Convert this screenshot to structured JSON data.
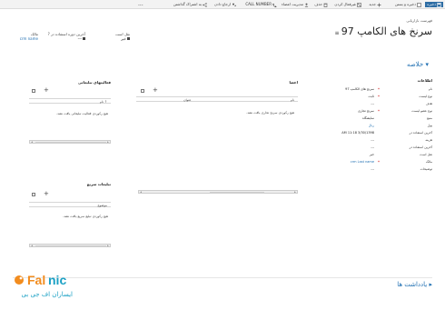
{
  "toolbar": {
    "items": [
      {
        "label": "ذخیره"
      },
      {
        "label": "ذخیره و بستن"
      },
      {
        "label": "جدید"
      },
      {
        "label": "غیرفعال کردن"
      },
      {
        "label": "حذف"
      },
      {
        "label": "مدیریت اعضاء"
      },
      {
        "label": "CALL NUMBER"
      },
      {
        "label": "ارجاع دادن"
      },
      {
        "label": "به اشتراک گذاشتن"
      }
    ],
    "more": "..."
  },
  "header": {
    "breadcrumb": "فهرست بازاریابی",
    "title": "سرنخ های الکامپ 97",
    "title_menu": "≡",
    "fields": [
      {
        "label": "نقل است",
        "value": "خیر"
      },
      {
        "label": "آخرین دوره استفاده در ?",
        "value": "---"
      },
      {
        "label": "مالک",
        "value": "crm name"
      }
    ]
  },
  "summary": {
    "section_title": "خلاصه",
    "info_title": "اطلاعات",
    "rows": [
      {
        "label": "نام",
        "required": true,
        "value": "سرنخ های الکامپ 97",
        "link": false
      },
      {
        "label": "نوع لیست",
        "required": true,
        "value": "ثابت",
        "link": false
      },
      {
        "label": "هدف",
        "required": false,
        "value": "---",
        "link": false
      },
      {
        "label": "نوع عضو لیست",
        "required": true,
        "value": "سرنخ تجاری",
        "link": false
      },
      {
        "label": "منبع",
        "required": false,
        "value": "نمایشگاه",
        "link": false
      },
      {
        "label": "پول",
        "required": false,
        "value": "ریال",
        "link": true
      },
      {
        "label": "آخرین استفاده در",
        "required": false,
        "value": "3/30/1398  11:18 AM",
        "link": false
      },
      {
        "label": "هزینه",
        "required": false,
        "value": "---",
        "link": false
      },
      {
        "label": "آخرین استفاده در",
        "required": false,
        "value": "---",
        "link": false
      },
      {
        "label": "نقل است",
        "required": false,
        "value": "خیر",
        "link": false
      },
      {
        "label": "مالک",
        "required": true,
        "value": "crm Last name",
        "link": true
      },
      {
        "label": "توضیحات",
        "required": false,
        "value": "---",
        "link": false
      }
    ]
  },
  "members_grid": {
    "title": "اعضا",
    "col_name": "نام",
    "col_title": "عنوان",
    "empty": "هیچ رکوردی سرنخ تجاری یافت نشد."
  },
  "activities_grid": {
    "title": "فعالیتهای تبلیغاتی",
    "col_name": "نام ↑",
    "empty": "هیچ رکوردی فعالیت تبلیغاتی یافت نشد."
  },
  "responses_grid": {
    "title": "تبلیغات سریع",
    "col_subject": "موضوع",
    "empty": "هیچ رکوردی تبلیغ سریع یافت نشد."
  },
  "notes": {
    "section_title": "یادداشت ها"
  },
  "logo": {
    "brand": "Falnic",
    "subtitle": "ایساران اف جی بی"
  },
  "colors": {
    "accent": "#1f6fb2",
    "toolbar_active": "#2e6da4",
    "logo_orange": "#f28c1e",
    "logo_teal": "#1aa0c4"
  }
}
